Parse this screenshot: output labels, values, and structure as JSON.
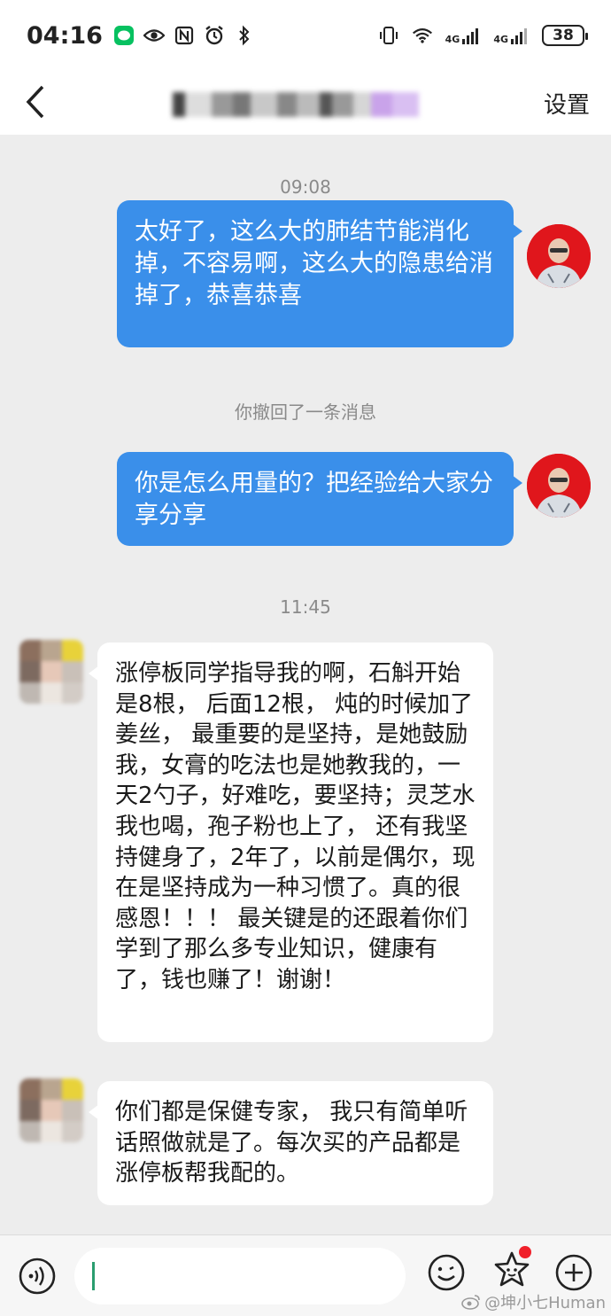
{
  "status_bar": {
    "time": "04:16",
    "signal_1": "4G",
    "signal_2": "4G",
    "battery": "38"
  },
  "nav": {
    "settings_label": "设置"
  },
  "messages": {
    "ts_1": "09:08",
    "sent_1": "太好了，这么大的肺结节能消化掉，不容易啊，这么大的隐患给消掉了，恭喜恭喜",
    "recall_note": "你撤回了一条消息",
    "sent_2": "你是怎么用量的？把经验给大家分享分享",
    "ts_2": "11:45",
    "recv_1": "涨停板同学指导我的啊，石斛开始是8根， 后面12根， 炖的时候加了姜丝， 最重要的是坚持，是她鼓励我，女膏的吃法也是她教我的，一天2勺子，好难吃，要坚持；灵芝水我也喝，孢子粉也上了， 还有我坚持健身了，2年了，以前是偶尔，现在是坚持成为一种习惯了。真的很感恩！！！ 最关键是的还跟着你们学到了那么多专业知识，健康有了，钱也赚了！谢谢！",
    "recv_2": "你们都是保健专家， 我只有简单听话照做就是了。每次买的产品都是涨停板帮我配的。"
  },
  "watermark": "@坤小七Human",
  "colors": {
    "sent_bubble": "#3a8fea",
    "recv_bubble": "#ffffff",
    "background": "#ededed",
    "badge": "#f0202a"
  }
}
